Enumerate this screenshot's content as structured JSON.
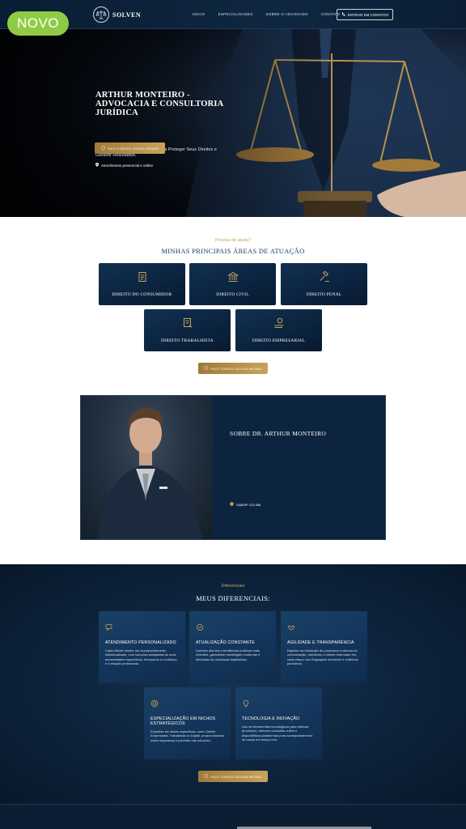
{
  "badge": {
    "label": "NOVO"
  },
  "header": {
    "logo_text": "SOLVEN",
    "nav": [
      "INÍCIO",
      "ESPECIALIDADES",
      "SOBRE O ADVOGADO",
      "CONTATO"
    ],
    "contact_button": "ENTRAR EM CONTATO!"
  },
  "hero": {
    "title": "ARTHUR MONTEIRO - ADVOCACIA E CONSULTORIA JURÍDICA",
    "subtitle": "Soluções Jurídicas Inteligentes para Proteger Seus Direitos e Garantir Resultados.",
    "location": "Atendimento presencial e online",
    "cta": "FALE COMIGO AGORA MESMO"
  },
  "areas": {
    "eyebrow": "Precisa de ajuda?",
    "title": "MINHAS PRINCIPAIS ÁREAS DE ATUAÇÃO",
    "items": [
      "DIREITO DO CONSUMIDOR",
      "DIREITO CIVIL",
      "DIREITO PENAL",
      "DIREITO TRABALHISTA",
      "DIREITO EMPRESARIAL"
    ],
    "cta": "FALE COMIGO AGORA MESMO"
  },
  "about": {
    "title": "SOBRE DR. ARTHUR MONTEIRO",
    "oab": "OAB/SP 123.456"
  },
  "diffs": {
    "eyebrow": "Diferenciais",
    "title": "MEUS DIFERENCIAIS:",
    "items": [
      {
        "title": "ATENDIMENTO PERSONALIZADO",
        "text": "Cada cliente recebe um acompanhamento individualizado, com soluções adaptadas às suas necessidades específicas, reforçando a confiança e a relação profissional."
      },
      {
        "title": "ATUALIZAÇÃO CONSTANTE",
        "text": "Domínio das leis e tendências jurídicas mais recentes, garantindo estratégias modernas e alinhadas às mudanças legislativas."
      },
      {
        "title": "AGILIDADE E TRANSPARÊNCIA",
        "text": "Rapidez na resolução de processos e clareza na comunicação, mantendo o cliente informado em cada etapa, com linguagem acessível e relatórios periódicos."
      },
      {
        "title": "ESPECIALIZAÇÃO EM NICHOS ESTRATÉGICOS",
        "text": "Expertise em áreas específicas, como Direito Empresarial, Trabalhista ou Digital, proporcionando maior segurança e precisão nas soluções."
      },
      {
        "title": "TECNOLOGIA E INOVAÇÃO",
        "text": "Uso de ferramentas tecnológicas para otimizar processos, oferecer consultas online e disponibilizar plataformas para acompanhamento de casos em tempo real."
      }
    ],
    "cta": "FALE COMIGO AGORA MESMO"
  },
  "colors": {
    "navy": "#0b2440",
    "gold": "#c9a25a",
    "accent_green": "#8fcb45",
    "title_blue": "#15375d"
  }
}
